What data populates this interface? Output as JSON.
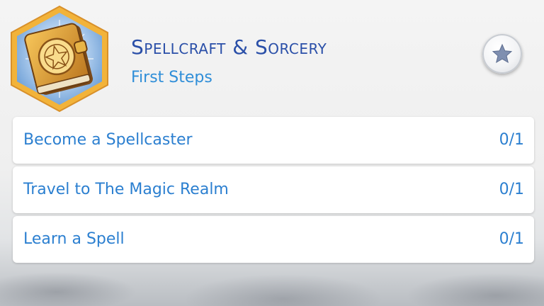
{
  "header": {
    "title": "Spellcraft & Sorcery",
    "subtitle": "First Steps",
    "badge_icon": "spellbook-icon",
    "action_icon": "star-icon"
  },
  "objectives": [
    {
      "label": "Become a Spellcaster",
      "progress": "0/1"
    },
    {
      "label": "Travel to The Magic Realm",
      "progress": "0/1"
    },
    {
      "label": "Learn a Spell",
      "progress": "0/1"
    }
  ],
  "colors": {
    "title": "#2a4fa8",
    "text_accent": "#2b7fd0",
    "badge_frame": "#f2b33a"
  }
}
